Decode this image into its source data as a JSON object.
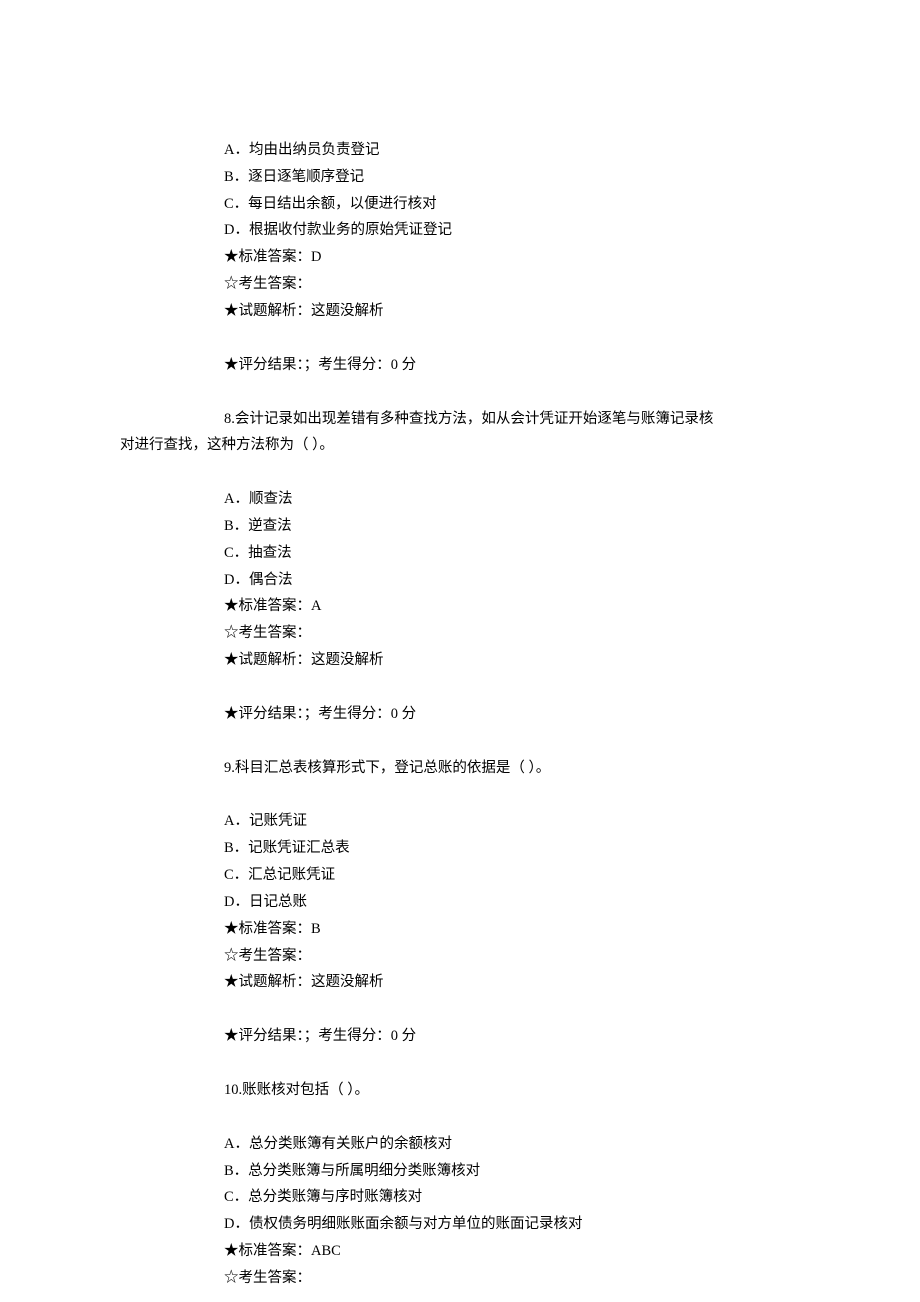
{
  "q7": {
    "optA_label": "A．",
    "optA_text": "均由出纳员负责登记",
    "optB_label": "B．",
    "optB_text": "逐日逐笔顺序登记",
    "optC_label": "C．",
    "optC_text": "每日结出余额，以便进行核对",
    "optD_label": "D．",
    "optD_text": "根据收付款业务的原始凭证登记",
    "std_label": "★标准答案：",
    "std_value": "D",
    "cand_label": "☆考生答案：",
    "cand_value": "",
    "expl_label": "★试题解析：",
    "expl_value": "这题没解析",
    "score_label": "★评分结果：",
    "score_value": "；考生得分：0 分"
  },
  "q8": {
    "number": "8.",
    "stem_line1": "会计记录如出现差错有多种查找方法，如从会计凭证开始逐笔与账簿记录核",
    "stem_line2": "对进行查找，这种方法称为（ ）。",
    "optA_label": "A．",
    "optA_text": "顺查法",
    "optB_label": "B．",
    "optB_text": "逆查法",
    "optC_label": "C．",
    "optC_text": "抽查法",
    "optD_label": "D．",
    "optD_text": "偶合法",
    "std_label": "★标准答案：",
    "std_value": "A",
    "cand_label": "☆考生答案：",
    "cand_value": "",
    "expl_label": "★试题解析：",
    "expl_value": "这题没解析",
    "score_label": "★评分结果：",
    "score_value": "；考生得分：0 分"
  },
  "q9": {
    "number": "9.",
    "stem": "科目汇总表核算形式下，登记总账的依据是（ ）。",
    "optA_label": "A．",
    "optA_text": "记账凭证",
    "optB_label": "B．",
    "optB_text": "记账凭证汇总表",
    "optC_label": "C．",
    "optC_text": "汇总记账凭证",
    "optD_label": "D．",
    "optD_text": "日记总账",
    "std_label": "★标准答案：",
    "std_value": "B",
    "cand_label": "☆考生答案：",
    "cand_value": "",
    "expl_label": "★试题解析：",
    "expl_value": "这题没解析",
    "score_label": "★评分结果：",
    "score_value": "；考生得分：0 分"
  },
  "q10": {
    "number": "10.",
    "stem": "账账核对包括（ ）。",
    "optA_label": "A．",
    "optA_text": "总分类账簿有关账户的余额核对",
    "optB_label": "B．",
    "optB_text": "总分类账簿与所属明细分类账簿核对",
    "optC_label": "C．",
    "optC_text": "总分类账簿与序时账簿核对",
    "optD_label": "D．",
    "optD_text": "债权债务明细账账面余额与对方单位的账面记录核对",
    "std_label": "★标准答案：",
    "std_value": "ABC",
    "cand_label": "☆考生答案：",
    "cand_value": ""
  }
}
